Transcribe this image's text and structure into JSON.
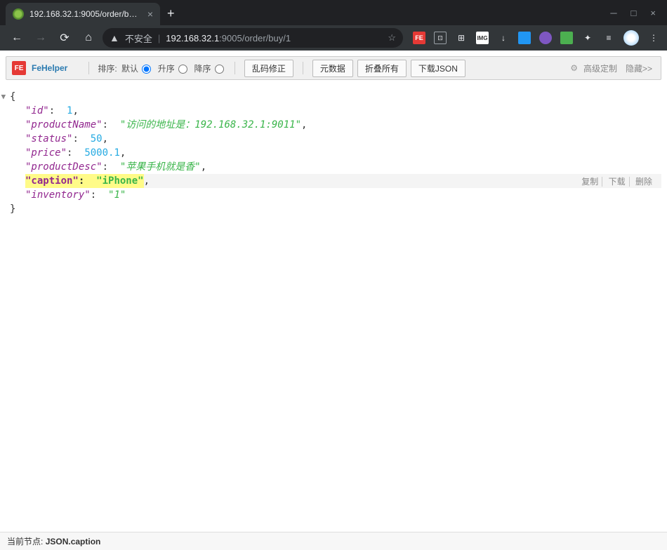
{
  "browser": {
    "tab_title": "192.168.32.1:9005/order/buy/1",
    "insecure_label": "不安全",
    "url_host": "192.168.32.1",
    "url_port_path": ":9005/order/buy/1"
  },
  "fehelper": {
    "name": "FeHelper",
    "sort_label": "排序:",
    "sort_default": "默认",
    "sort_asc": "升序",
    "sort_desc": "降序",
    "btn_fix": "乱码修正",
    "btn_meta": "元数据",
    "btn_collapse": "折叠所有",
    "btn_download": "下载JSON",
    "link_advanced": "高级定制",
    "link_hide": "隐藏>>"
  },
  "json": {
    "id_key": "\"id\"",
    "id_val": "1",
    "productName_key": "\"productName\"",
    "productName_val": "\"访问的地址是：192.168.32.1:9011\"",
    "status_key": "\"status\"",
    "status_val": "50",
    "price_key": "\"price\"",
    "price_val": "5000.1",
    "productDesc_key": "\"productDesc\"",
    "productDesc_val": "\"苹果手机就是香\"",
    "caption_key": "\"caption\"",
    "caption_val": "\"iPhone\"",
    "inventory_key": "\"inventory\"",
    "inventory_val": "\"1\""
  },
  "row_actions": {
    "copy": "复制",
    "download": "下载",
    "delete": "删除"
  },
  "status": {
    "label": "当前节点:",
    "path": "JSON.caption"
  }
}
